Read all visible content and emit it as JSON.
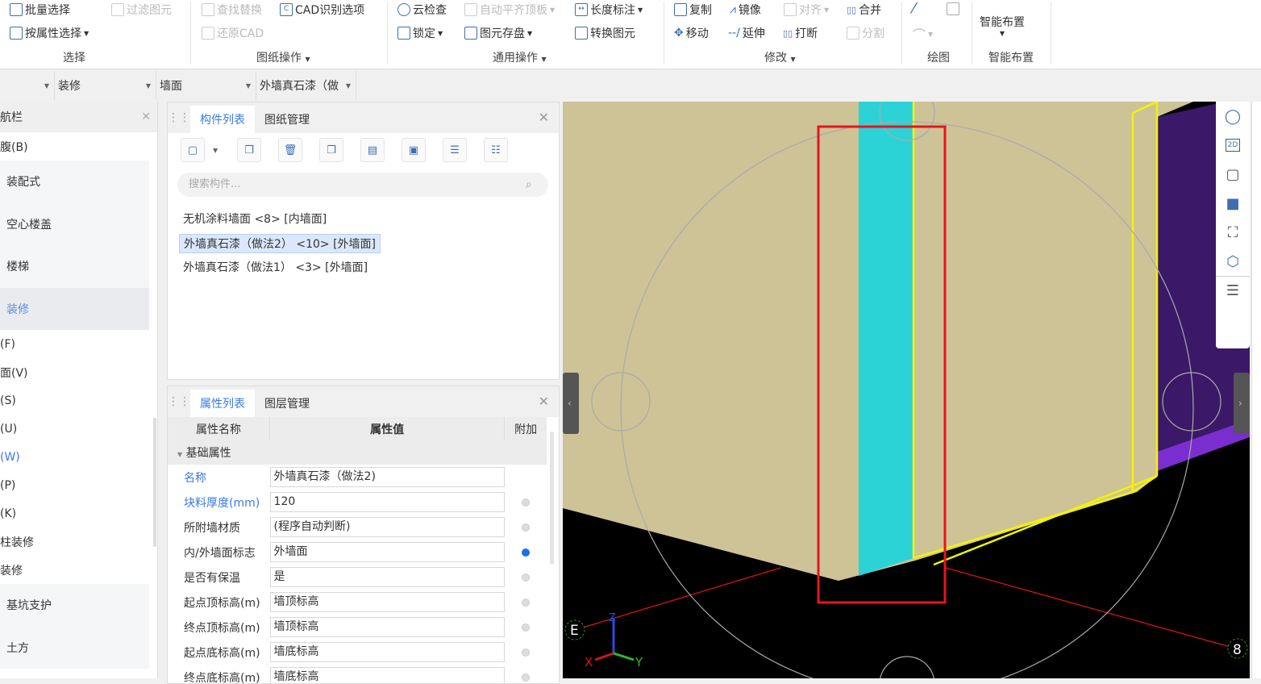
{
  "ribbon": {
    "select": {
      "batch": "批量选择",
      "filter": "过滤图元",
      "by_attr": "按属性选择",
      "group": "选择"
    },
    "drawing": {
      "find_replace": "查找替换",
      "cad_options": "CAD识别选项",
      "restore_cad": "还原CAD",
      "group": "图纸操作"
    },
    "common": {
      "cloud_check": "云检查",
      "auto_align": "自动平齐顶板",
      "dim": "长度标注",
      "lock": "锁定",
      "save_elements": "图元存盘",
      "convert": "转换图元",
      "group": "通用操作"
    },
    "modify": {
      "copy": "复制",
      "mirror": "镜像",
      "align": "对齐",
      "merge": "合并",
      "move": "移动",
      "extend": "延伸",
      "break": "打断",
      "split": "分割",
      "group": "修改"
    },
    "draw": {
      "group": "绘图"
    },
    "smart": {
      "label": "智能布置",
      "group": "智能布置"
    }
  },
  "filters": {
    "c1": "",
    "c2": "装修",
    "c3": "墙面",
    "c4": "外墙真石漆（做"
  },
  "nav": {
    "title": "航栏",
    "items": [
      "腹(B)",
      "装配式",
      "空心楼盖",
      "楼梯",
      "装修",
      "(F)",
      "面(V)",
      "(S)",
      "(U)",
      "(W)",
      "(P)",
      "(K)",
      "柱装修",
      "装修",
      "基坑支护",
      "土方"
    ]
  },
  "components": {
    "tabs": [
      "构件列表",
      "图纸管理"
    ],
    "search_placeholder": "搜索构件...",
    "items": [
      "无机涂料墙面 <8> [内墙面]",
      "外墙真石漆（做法2） <10> [外墙面]",
      "外墙真石漆（做法1） <3> [外墙面]"
    ]
  },
  "properties": {
    "tabs": [
      "属性列表",
      "图层管理"
    ],
    "headers": [
      "属性名称",
      "属性值",
      "附加"
    ],
    "section": "基础属性",
    "rows": [
      {
        "name": "名称",
        "value": "外墙真石漆（做法2)"
      },
      {
        "name": "块料厚度(mm)",
        "value": "120"
      },
      {
        "name": "所附墙材质",
        "value": "(程序自动判断)"
      },
      {
        "name": "内/外墙面标志",
        "value": "外墙面"
      },
      {
        "name": "是否有保温",
        "value": "是"
      },
      {
        "name": "起点顶标高(m)",
        "value": "墙顶标高"
      },
      {
        "name": "终点顶标高(m)",
        "value": "墙顶标高"
      },
      {
        "name": "起点底标高(m)",
        "value": "墙底标高"
      },
      {
        "name": "终点底标高(m)",
        "value": "墙底标高"
      }
    ]
  },
  "viewport": {
    "axis_e": "E",
    "axis_8": "8",
    "x": "X",
    "y": "Y",
    "z": "Z",
    "vt_2d": "2D"
  },
  "colors": {
    "accent": "#3a7be0",
    "wall": "#cfc59a",
    "cyan": "#2bd3d6",
    "purple": "#3f1a6b",
    "highlight": "#e8141c"
  }
}
